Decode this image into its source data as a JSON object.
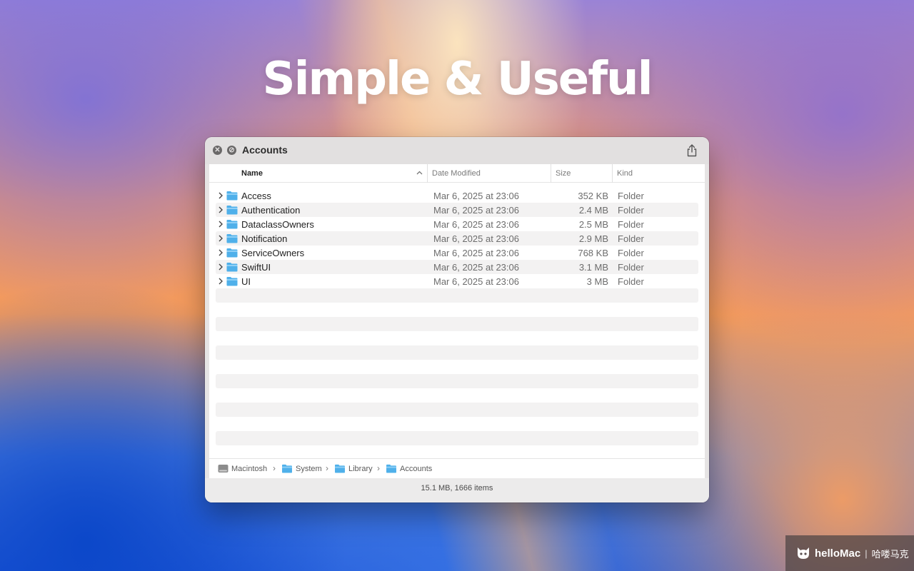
{
  "headline": "Simple & Useful",
  "window": {
    "title": "Accounts",
    "close_glyph": "✕",
    "minimize_glyph": "⊘"
  },
  "columns": {
    "name": "Name",
    "date": "Date Modified",
    "size": "Size",
    "kind": "Kind"
  },
  "files": [
    {
      "name": "Access",
      "date": "Mar 6, 2025 at 23:06",
      "size": "352 KB",
      "kind": "Folder"
    },
    {
      "name": "Authentication",
      "date": "Mar 6, 2025 at 23:06",
      "size": "2.4 MB",
      "kind": "Folder"
    },
    {
      "name": "DataclassOwners",
      "date": "Mar 6, 2025 at 23:06",
      "size": "2.5 MB",
      "kind": "Folder"
    },
    {
      "name": "Notification",
      "date": "Mar 6, 2025 at 23:06",
      "size": "2.9 MB",
      "kind": "Folder"
    },
    {
      "name": "ServiceOwners",
      "date": "Mar 6, 2025 at 23:06",
      "size": "768 KB",
      "kind": "Folder"
    },
    {
      "name": "SwiftUI",
      "date": "Mar 6, 2025 at 23:06",
      "size": "3.1 MB",
      "kind": "Folder"
    },
    {
      "name": "UI",
      "date": "Mar 6, 2025 at 23:06",
      "size": "3 MB",
      "kind": "Folder"
    }
  ],
  "path": {
    "items": [
      "Macintosh",
      "System",
      "Library",
      "Accounts"
    ],
    "separator": "›"
  },
  "status": "15.1 MB, 1666 items",
  "watermark": {
    "brand": "helloMac",
    "separator": "|",
    "chinese": "哈喽马克"
  },
  "colors": {
    "folder": "#4fb0ea",
    "folder_tab": "#8fd0f6",
    "window_bg": "#e6e4e4"
  }
}
